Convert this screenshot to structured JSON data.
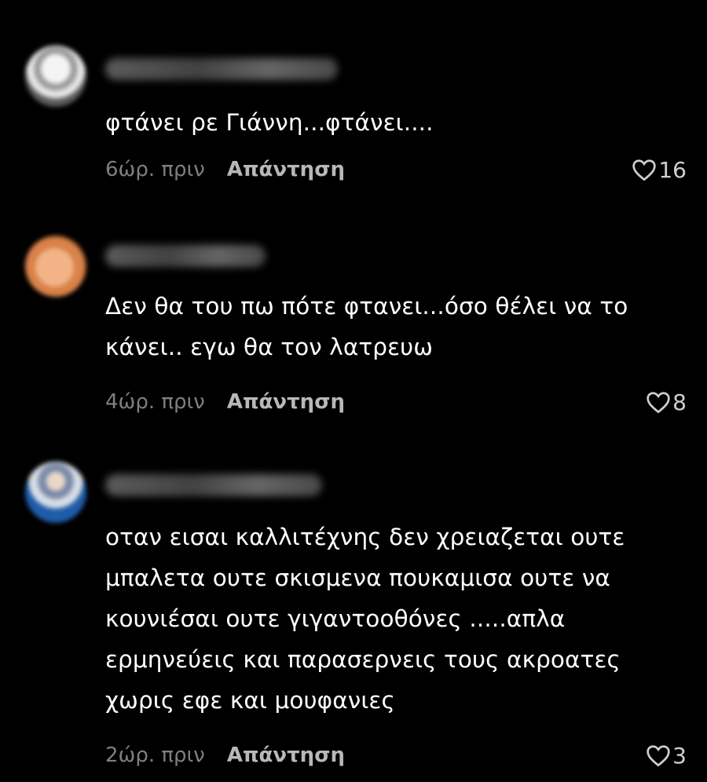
{
  "comments": [
    {
      "text_lines": [
        "φτάνει ρε Γιάννη...φτάνει...."
      ],
      "time": "6ώρ. πριν",
      "reply_label": "Απάντηση",
      "likes": "16"
    },
    {
      "text_lines": [
        "Δεν θα του πω πότε φτανει...όσο θέλει να το",
        "κάνει.. εγω θα τον λατρευω"
      ],
      "time": "4ώρ. πριν",
      "reply_label": "Απάντηση",
      "likes": "8"
    },
    {
      "text_lines": [
        "οταν εισαι καλλιτέχνης δεν χρειαζεται ουτε",
        "μπαλετα ουτε σκισμενα πουκαμισα ουτε να",
        "κουνιέσαι ουτε γιγαντοοθόνες .....απλα",
        "ερμηνεύεις και παρασερνεις τους ακροατες",
        "χωρις εφε και μουφανιες"
      ],
      "time": "2ώρ. πριν",
      "reply_label": "Απάντηση",
      "likes": "3"
    }
  ],
  "icons": {
    "like": "heart-outline-icon"
  },
  "colors": {
    "background": "#000000",
    "text": "#ffffff",
    "timestamp": "#7f7f7f",
    "reply": "#b8b8b8"
  }
}
